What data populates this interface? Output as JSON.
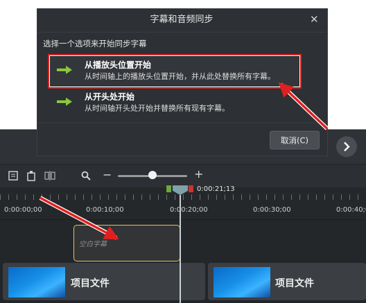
{
  "dialog": {
    "title": "字幕和音频同步",
    "subtitle": "选择一个选项来开始同步字幕",
    "options": [
      {
        "title": "从播放头位置开始",
        "description": "从时间轴上的播放头位置开始，并从此处替换所有字幕。",
        "selected": true
      },
      {
        "title": "从开头处开始",
        "description": "从时间轴开头处开始并替换所有现有字幕。",
        "selected": false
      }
    ],
    "cancel_label": "取消(C)"
  },
  "timeline": {
    "playhead_time": "0:00:21;13",
    "ruler_labels": [
      "0:00:00;00",
      "0:00:10;00",
      "0:00:20;00",
      "0:00:30;00",
      "0:00:40;0"
    ],
    "caption_clip_label": "空白字幕",
    "media_clips": [
      {
        "label": "项目文件"
      },
      {
        "label": "项目文件"
      }
    ]
  },
  "colors": {
    "annotation_red": "#e02020",
    "highlight_border": "#d32323",
    "caption_border": "#e8c45a",
    "arrow_green": "#8cc63f"
  }
}
